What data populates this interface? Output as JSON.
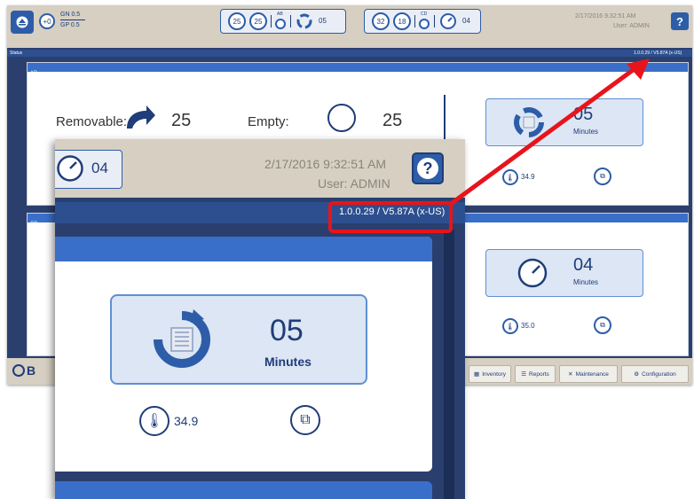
{
  "header": {
    "gn": "GN 0.5",
    "gp": "GP 0.5",
    "counter_zero": "+0",
    "group_ab": {
      "removable": "25",
      "empty": "25",
      "label": "AB",
      "time": "05"
    },
    "group_cd": {
      "removable": "32",
      "empty": "18",
      "label": "CD",
      "time": "04"
    },
    "datetime": "2/17/2016 9:32:51 AM",
    "user": "User: ADMIN",
    "help": "?"
  },
  "status": {
    "label": "Status",
    "version": "1.0.0.29 / V5.87A (x-US)"
  },
  "panel_ab": {
    "title": "AB",
    "removable_label": "Removable:",
    "removable_count": "25",
    "empty_label": "Empty:",
    "empty_count": "25",
    "cycle_value": "05",
    "cycle_unit": "Minutes",
    "temperature": "34.9"
  },
  "panel_cd": {
    "title": "CD",
    "cycle_value": "04",
    "cycle_unit": "Minutes",
    "temperature": "35.0"
  },
  "nav": {
    "inventory": "Inventory",
    "reports": "Reports",
    "maintenance": "Maintenance",
    "configuration": "Configuration",
    "logo_letter": "B"
  },
  "zoom": {
    "timer_value": "04",
    "datetime": "2/17/2016 9:32:51 AM",
    "user": "User: ADMIN",
    "help": "?",
    "version": "1.0.0.29 / V5.87A (x-US)",
    "cycle_value": "05",
    "cycle_unit": "Minutes",
    "temperature": "34.9"
  },
  "colors": {
    "accent": "#3a6fc9",
    "header_bg": "#d6cfc2",
    "highlight": "#e8141b"
  }
}
